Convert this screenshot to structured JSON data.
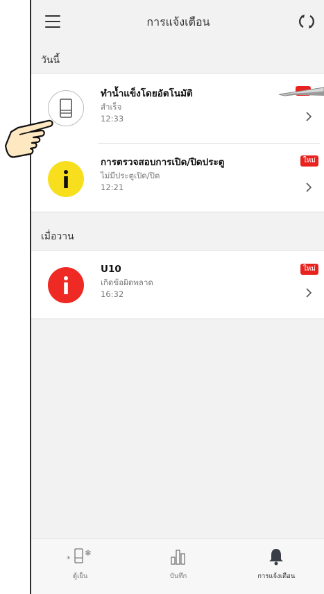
{
  "header": {
    "title": "การแจ้งเตือน",
    "menu_icon": "hamburger-menu-icon",
    "refresh_icon": "refresh-icon"
  },
  "sections": [
    {
      "label": "วันนี้",
      "items": [
        {
          "title": "ทำน้ำแข็งโดยอัตโนมัติ",
          "subtitle": "สำเร็จ",
          "time": "12:33",
          "icon": "fridge-icon",
          "icon_color": "#ffffff",
          "badge": ""
        },
        {
          "title": "การตรวจสอบการเปิด/ปิดประตู",
          "subtitle": "ไม่มีประตูเปิด/ปิด",
          "time": "12:21",
          "icon": "info-icon",
          "icon_color": "#f7df1e",
          "badge": "ใหม่"
        }
      ]
    },
    {
      "label": "เมื่อวาน",
      "items": [
        {
          "title": "U10",
          "subtitle": "เกิดข้อผิดพลาด",
          "time": "16:32",
          "icon": "info-icon",
          "icon_color": "#ef2a24",
          "badge": "ใหม่"
        }
      ]
    }
  ],
  "bottom_nav": [
    {
      "label": "ตู้เย็น",
      "icon": "fridge-snow-icon",
      "active": false
    },
    {
      "label": "บันทึก",
      "icon": "bar-chart-icon",
      "active": false
    },
    {
      "label": "การแจ้งเตือน",
      "icon": "bell-icon",
      "active": true
    }
  ],
  "colors": {
    "badge": "#e8231f",
    "background": "#f2f2f2",
    "card": "#ffffff"
  }
}
